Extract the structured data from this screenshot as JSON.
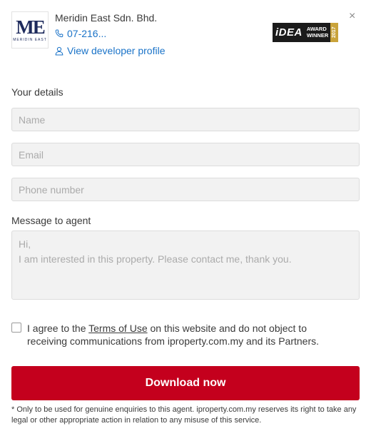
{
  "agent": {
    "logo_text": "ME",
    "logo_subtext": "MERIDIN EAST",
    "name": "Meridin East Sdn. Bhd.",
    "phone": "07-216...",
    "profile_link": "View developer profile"
  },
  "award": {
    "brand": "iDEA",
    "line1": "AWARD",
    "line2": "WINNER",
    "year": "2017"
  },
  "close_label": "×",
  "form": {
    "your_details_label": "Your details",
    "name_placeholder": "Name",
    "email_placeholder": "Email",
    "phone_placeholder": "Phone number",
    "message_label": "Message to agent",
    "message_placeholder": "Hi,\nI am interested in this property. Please contact me, thank you.",
    "consent_prefix": "I agree to the ",
    "terms_link": "Terms of Use",
    "consent_suffix": " on this website and do not object to receiving communications from iproperty.com.my and its Partners.",
    "submit_label": "Download now",
    "disclaimer": "* Only to be used for genuine enquiries to this agent. iproperty.com.my reserves its right to take any legal or other appropriate action in relation to any misuse of this service."
  },
  "colors": {
    "link": "#1a73c8",
    "primary_button": "#c4001d",
    "award_gold": "#c9a33a"
  },
  "icons": {
    "phone": "phone-icon",
    "profile": "person-icon",
    "close": "close-icon"
  }
}
